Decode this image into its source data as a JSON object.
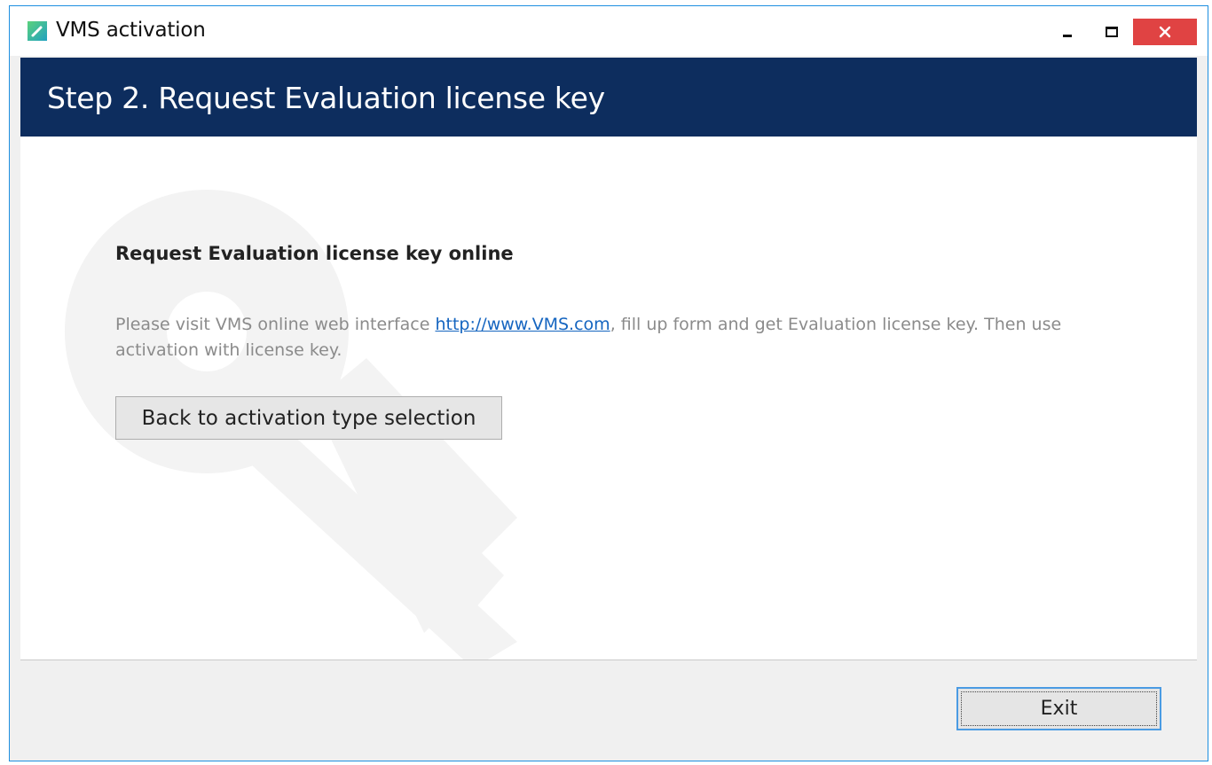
{
  "window": {
    "title": "VMS activation",
    "icon": "vms-app-icon",
    "controls": {
      "minimize": "minimize-icon",
      "maximize": "maximize-icon",
      "close": "close-icon"
    }
  },
  "header": {
    "title": "Step 2. Request Evaluation license key"
  },
  "main": {
    "heading": "Request Evaluation license key online",
    "description_before": "Please visit VMS online web interface ",
    "link_text": "http://www.VMS.com",
    "description_after": ", fill up form and get Evaluation license key. Then use activation with license key.",
    "back_button_label": "Back to activation type selection",
    "watermark_icon": "key-icon"
  },
  "footer": {
    "exit_label": "Exit"
  },
  "colors": {
    "header_band": "#0d2d5e",
    "window_border": "#1d8fe0",
    "close_button": "#e04343",
    "link": "#1565c0"
  }
}
